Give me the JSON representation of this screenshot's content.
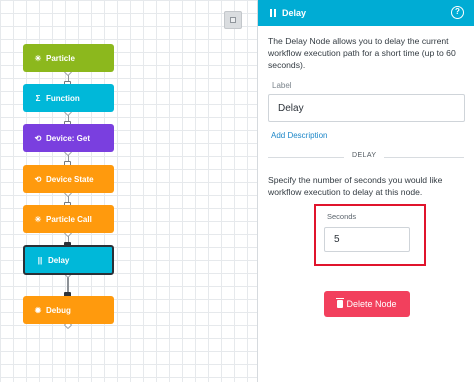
{
  "canvas": {
    "nodes": [
      {
        "label": "Particle",
        "icon": "✳",
        "icon_name": "particle-icon",
        "color": "#8cb81d"
      },
      {
        "label": "Function",
        "icon": "Σ",
        "icon_name": "sigma-icon",
        "color": "#00b8d9"
      },
      {
        "label": "Device: Get",
        "icon": "⟲",
        "icon_name": "device-get-icon",
        "color": "#7a3fdf"
      },
      {
        "label": "Device State",
        "icon": "⟲",
        "icon_name": "device-state-icon",
        "color": "#ff9a0d"
      },
      {
        "label": "Particle Call",
        "icon": "✳",
        "icon_name": "particle-call-icon",
        "color": "#ff9a0d"
      },
      {
        "label": "Delay",
        "icon": "||",
        "icon_name": "pause-icon",
        "color": "#00b8d9",
        "selected": true
      },
      {
        "label": "Debug",
        "icon": "✹",
        "icon_name": "debug-icon",
        "color": "#ff9a0d"
      }
    ]
  },
  "panel": {
    "header_title": "Delay",
    "help_glyph": "?",
    "description": "The Delay Node allows you to delay the current workflow execution path for a short time (up to 60 seconds).",
    "label_caption": "Label",
    "label_value": "Delay",
    "add_description": "Add Description",
    "section_title": "DELAY",
    "specify_text": "Specify the number of seconds you would like workflow execution to delay at this node.",
    "seconds_caption": "Seconds",
    "seconds_value": "5",
    "delete_label": "Delete Node"
  },
  "colors": {
    "header": "#00acd4",
    "delete": "#f2405d",
    "highlight": "#e0142c",
    "link": "#1d87c8"
  }
}
